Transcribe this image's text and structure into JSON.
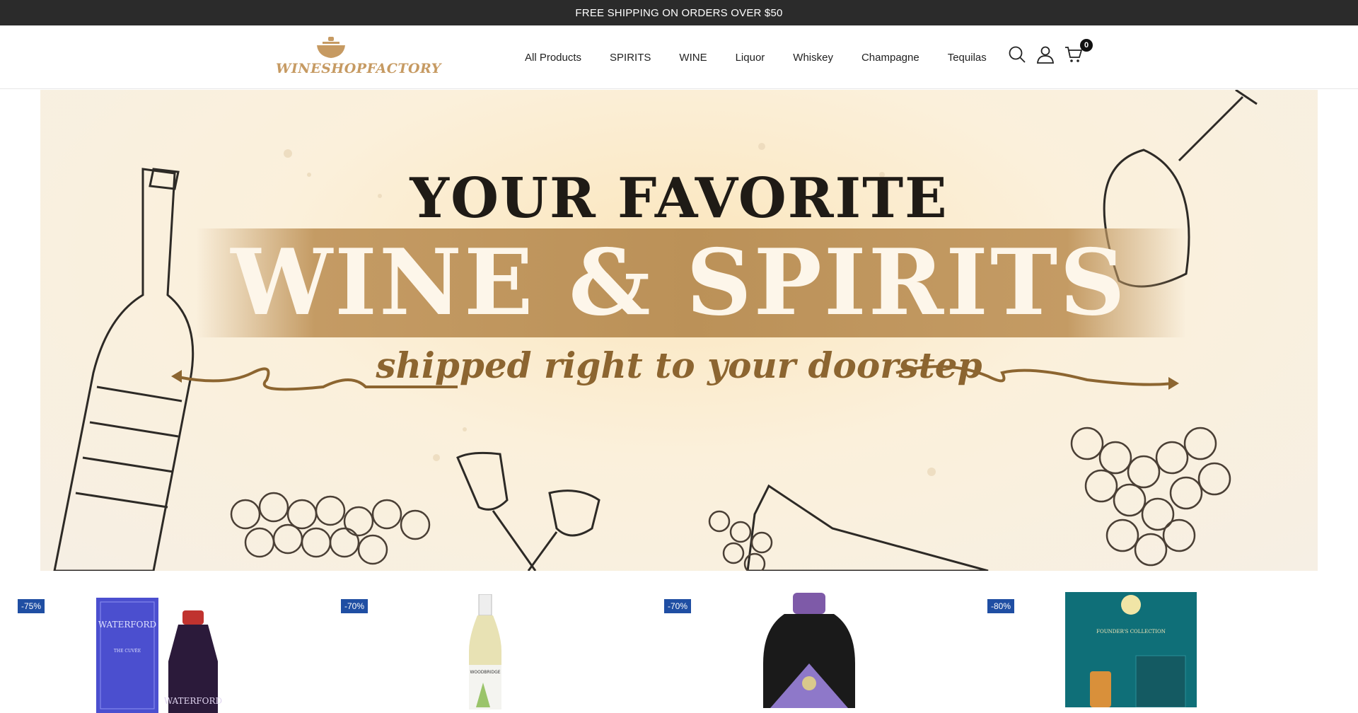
{
  "announcement": "FREE SHIPPING ON ORDERS OVER $50",
  "logo": {
    "text": "WINESHOPFACTORY"
  },
  "nav": {
    "items": [
      {
        "label": "All Products"
      },
      {
        "label": "SPIRITS"
      },
      {
        "label": "WINE"
      },
      {
        "label": "Liquor"
      },
      {
        "label": "Whiskey"
      },
      {
        "label": "Champagne"
      },
      {
        "label": "Tequilas"
      }
    ]
  },
  "header_icons": {
    "search": "search-icon",
    "account": "user-icon",
    "cart": "cart-icon",
    "cart_count": "0"
  },
  "hero": {
    "line1": "YOUR FAVORITE",
    "line2": "WINE & SPIRITS",
    "line3": "shipped right to your doorstep"
  },
  "products": [
    {
      "discount": "-75%",
      "box_text": "WATERFORD",
      "sub_text": "THE CUVÉE",
      "bottle_text": "WATERFORD"
    },
    {
      "discount": "-70%",
      "label_text": "WOODBRIDGE"
    },
    {
      "discount": "-70%"
    },
    {
      "discount": "-80%",
      "box_text": "FOUNDER'S COLLECTION"
    }
  ],
  "colors": {
    "accent_gold": "#c69a62",
    "badge_blue": "#1f4ea3",
    "topbar": "#2b2b2b"
  }
}
